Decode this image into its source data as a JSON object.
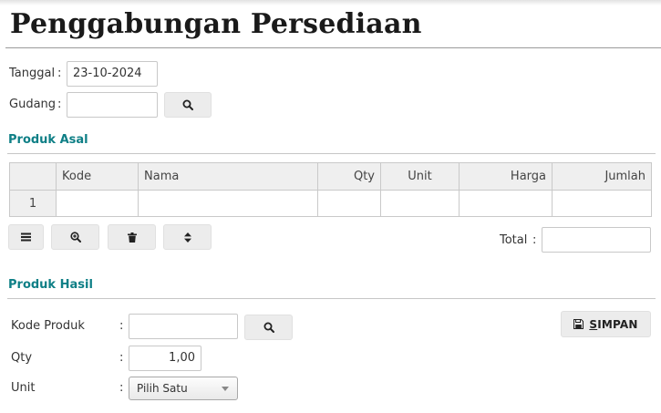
{
  "page": {
    "title": "Penggabungan Persediaan"
  },
  "header_form": {
    "tanggal_label": "Tanggal",
    "tanggal_value": "23-10-2024",
    "gudang_label": "Gudang",
    "gudang_value": "",
    "colon": ":"
  },
  "produk_asal": {
    "title": "Produk Asal",
    "columns": [
      "",
      "Kode",
      "Nama",
      "Qty",
      "Unit",
      "Harga",
      "Jumlah"
    ],
    "rows": [
      {
        "no": "1",
        "kode": "",
        "nama": "",
        "qty": "",
        "unit": "",
        "harga": "",
        "jumlah": ""
      }
    ],
    "toolbar_icons": [
      "menu-icon",
      "zoom-in-icon",
      "trash-icon",
      "sort-icon"
    ],
    "total_label": "Total",
    "total_value": ""
  },
  "produk_hasil": {
    "title": "Produk Hasil",
    "kode_produk_label": "Kode Produk",
    "kode_produk_value": "",
    "qty_label": "Qty",
    "qty_value": "1,00",
    "unit_label": "Unit",
    "unit_selected": "Pilih Satu"
  },
  "actions": {
    "save_label_first": "S",
    "save_label_rest": "IMPAN",
    "save_icon": "floppy-disk-icon"
  },
  "colors": {
    "section_title": "#0e7f86",
    "button_bg": "#ececec",
    "table_header_bg": "#efefef"
  }
}
